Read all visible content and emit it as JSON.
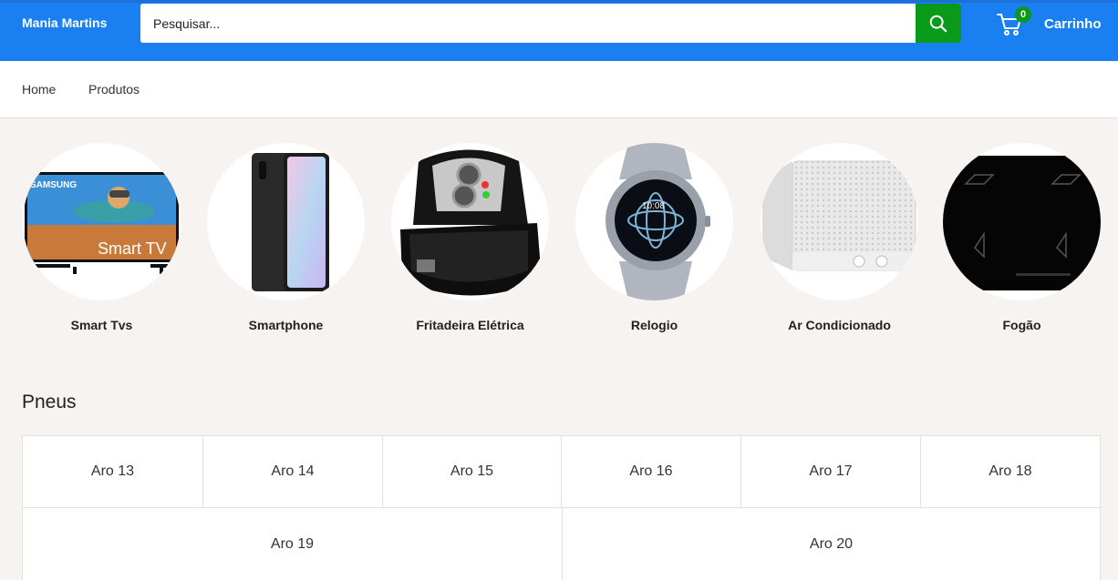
{
  "header": {
    "brand": "Mania Martins",
    "search_placeholder": "Pesquisar...",
    "search_icon": "search-icon",
    "cart_icon": "cart-icon",
    "cart_count": "0",
    "cart_label": "Carrinho"
  },
  "nav": {
    "items": [
      {
        "label": "Home"
      },
      {
        "label": "Produtos"
      }
    ]
  },
  "categories": [
    {
      "label": "Smart Tvs"
    },
    {
      "label": "Smartphone"
    },
    {
      "label": "Fritadeira Elétrica"
    },
    {
      "label": "Relogio"
    },
    {
      "label": "Ar Condicionado"
    },
    {
      "label": "Fogão"
    }
  ],
  "tv_brand_text": "SAMSUNG",
  "tv_screen_text": "Smart TV",
  "watch_time": "10:08",
  "pneus": {
    "title": "Pneus",
    "items": [
      {
        "label": "Aro 13"
      },
      {
        "label": "Aro 14"
      },
      {
        "label": "Aro 15"
      },
      {
        "label": "Aro 16"
      },
      {
        "label": "Aro 17"
      },
      {
        "label": "Aro 18"
      },
      {
        "label": "Aro 19"
      },
      {
        "label": "Aro 20"
      }
    ]
  },
  "colors": {
    "header_bg": "#1a7ff0",
    "accent_green": "#0a9a1a",
    "page_bg": "#f6f3f1"
  }
}
